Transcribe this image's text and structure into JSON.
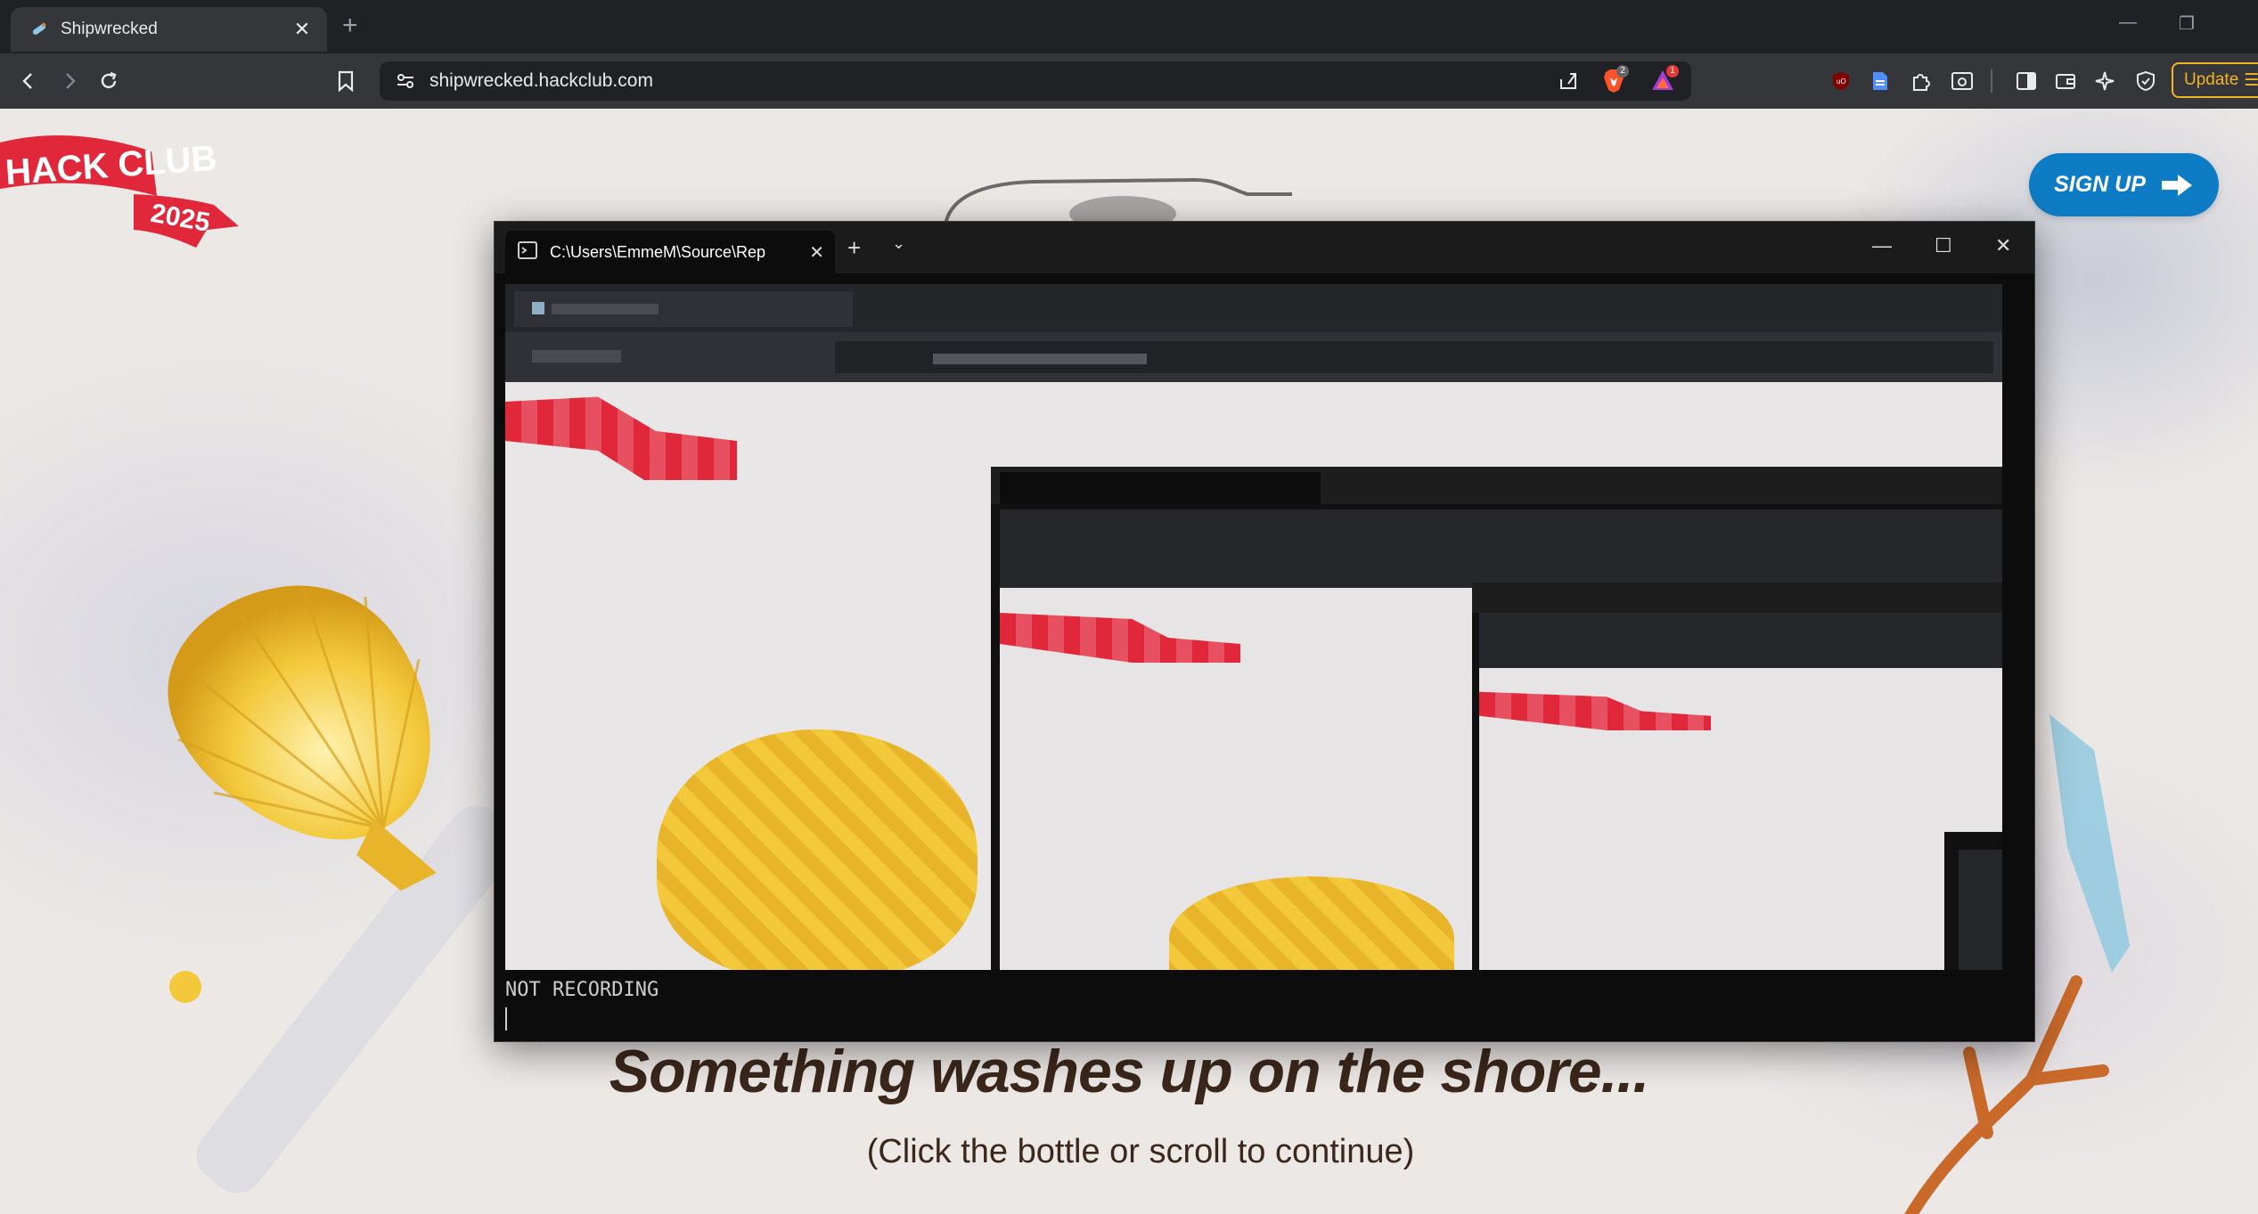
{
  "browser": {
    "tab_title": "Shipwrecked",
    "url": "shipwrecked.hackclub.com",
    "update_label": "Update",
    "brave_badge": "2",
    "notif_badge": "1"
  },
  "site": {
    "logo_top": "HACK CLUB",
    "logo_year": "2025",
    "signup_label": "SIGN UP",
    "headline": "Something washes up on the shore...",
    "subline": "(Click the bottle or scroll to continue)"
  },
  "terminal": {
    "tab_title": "C:\\Users\\EmmeM\\Source\\Rep",
    "status": "NOT RECORDING"
  },
  "colors": {
    "accent_blue": "#0e7cc4",
    "headline_brown": "#3b271b",
    "logo_red": "#e0283a",
    "shell_yellow": "#f3c93b"
  }
}
